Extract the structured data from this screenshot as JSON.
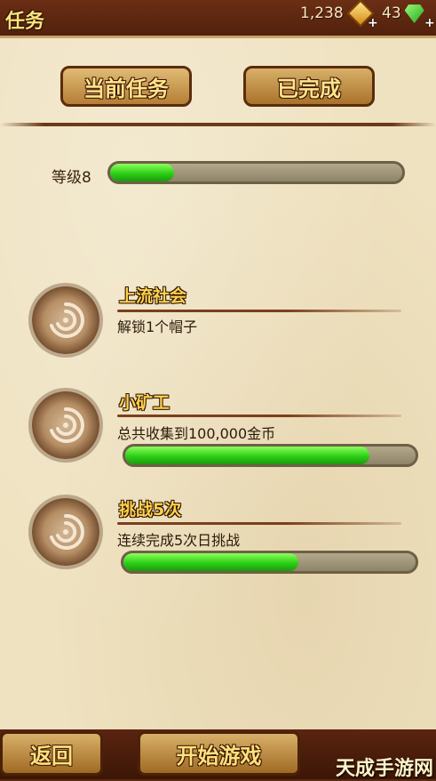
{
  "header": {
    "title": "任务",
    "coins": "1,238",
    "gems": "43",
    "plus": "+"
  },
  "tabs": [
    {
      "label": "当前任务",
      "active": true
    },
    {
      "label": "已完成",
      "active": false
    }
  ],
  "level": {
    "label": "等级8",
    "progress": 0.22
  },
  "tasks": [
    {
      "title": "上流社会",
      "desc": "解锁1个帽子"
    },
    {
      "title": "小矿工",
      "desc": "总共收集到100,000金币",
      "progress": 0.84
    },
    {
      "title": "挑战5次",
      "desc": "连续完成5次日挑战",
      "progress": 0.6
    }
  ],
  "footer": {
    "back_label": "返回",
    "start_label": "开始游戏",
    "watermark": "天成手游网"
  },
  "colors": {
    "accent_gold": "#ffd24a",
    "progress_green": "#2ccf16",
    "parchment": "#efe2c0",
    "leather": "#4a1f0c"
  }
}
